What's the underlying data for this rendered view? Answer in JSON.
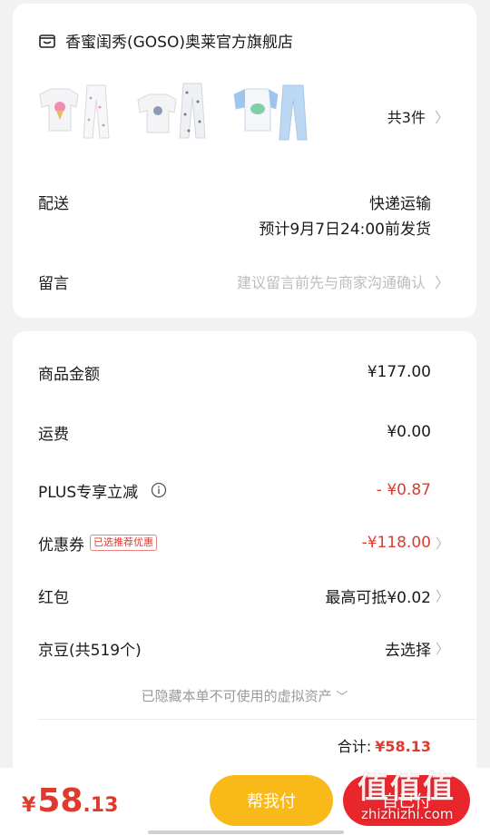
{
  "store": {
    "icon": "store-icon",
    "name": "香蜜闺秀(GOSO)奥莱官方旗舰店"
  },
  "products": {
    "items": [
      {
        "icon": "pajama-white-icecream-image",
        "accent": "#f08db3"
      },
      {
        "icon": "pajama-white-print-image",
        "accent": "#8a9bb8"
      },
      {
        "icon": "pajama-blue-dino-image",
        "accent": "#9cc6ee"
      }
    ],
    "count_label": "共3件"
  },
  "shipping": {
    "label": "配送",
    "method": "快递运输",
    "eta": "预计9月7日24:00前发货"
  },
  "message": {
    "label": "留言",
    "placeholder": "建议留言前先与商家沟通确认"
  },
  "summary": {
    "goods_label": "商品金额",
    "goods_value": "¥177.00",
    "freight_label": "运费",
    "freight_value": "¥0.00",
    "plus_label": "PLUS专享立减",
    "plus_value": "- ¥0.87",
    "coupon_label": "优惠券",
    "coupon_tag": "已选推荐优惠",
    "coupon_value": "-¥118.00",
    "redpacket_label": "红包",
    "redpacket_value": "最高可抵¥0.02",
    "jingdou_label": "京豆(共519个)",
    "jingdou_value": "去选择",
    "hidden_assets": "已隐藏本单不可使用的虚拟资产",
    "total_label": "合计:",
    "total_value": "¥58.13"
  },
  "footer": {
    "currency": "¥",
    "amount_int": "58",
    "amount_dec": ".13",
    "help_button": "帮我付",
    "self_button": "自己付"
  },
  "watermark": {
    "chars": "值值值",
    "domain": "zhizhizhi.com"
  },
  "colors": {
    "accent_red": "#e03a2f",
    "help_yellow": "#f9b918",
    "pay_red": "#e8262c"
  }
}
